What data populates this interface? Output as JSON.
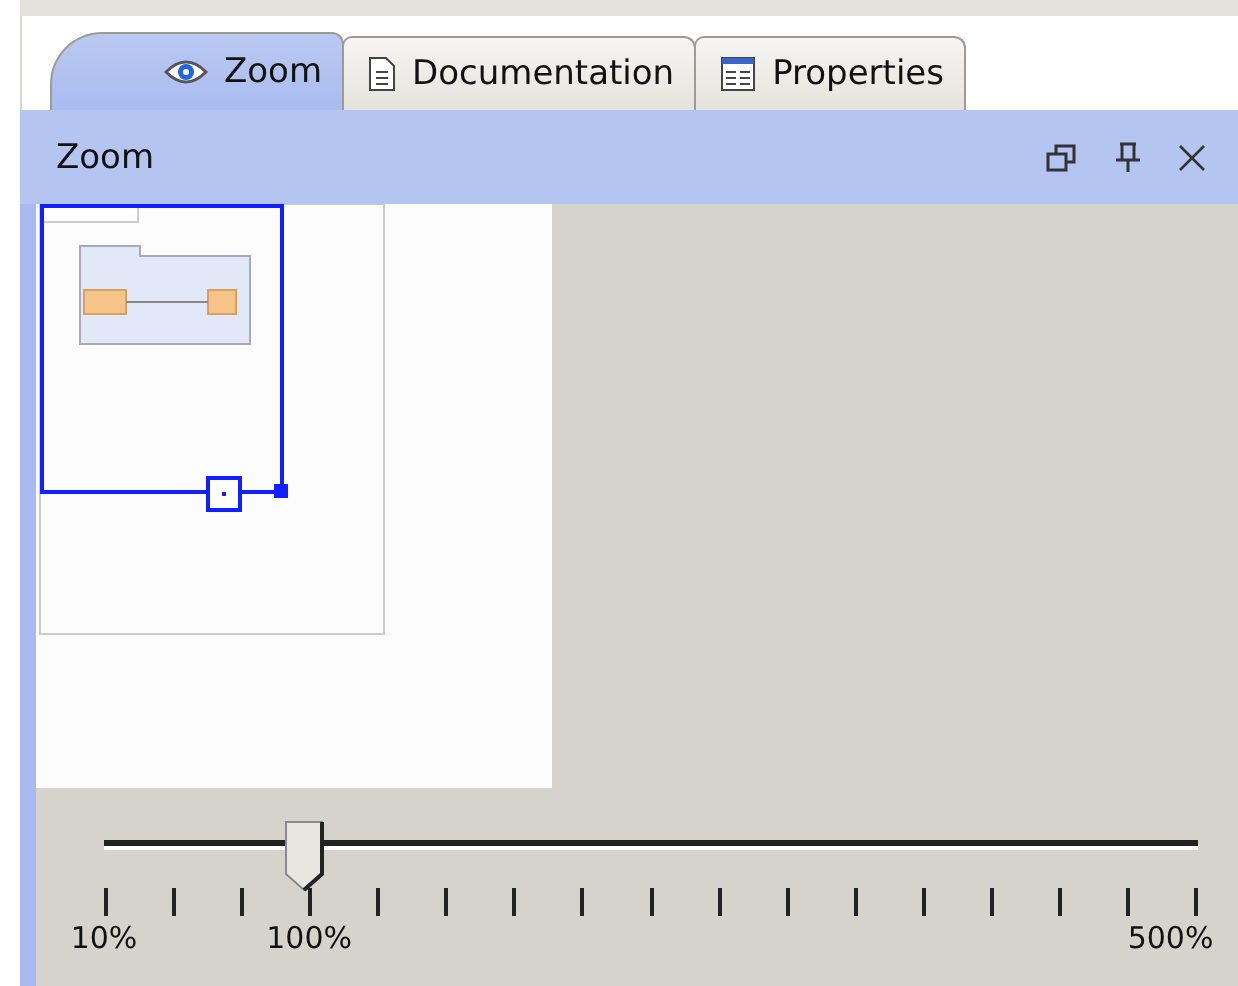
{
  "tabs": [
    {
      "label": "Zoom",
      "kind": "eye",
      "selected": true
    },
    {
      "label": "Documentation",
      "kind": "document",
      "selected": false
    },
    {
      "label": "Properties",
      "kind": "table",
      "selected": false
    }
  ],
  "panel": {
    "title": "Zoom"
  },
  "slider": {
    "level": 0.183,
    "labels": [
      "10%",
      "100%",
      "500%"
    ]
  }
}
